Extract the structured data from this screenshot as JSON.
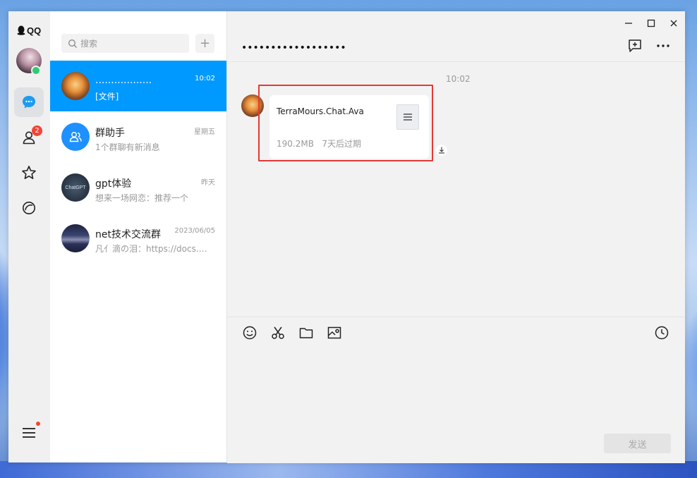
{
  "app": {
    "logo_text": "QQ"
  },
  "rail": {
    "badge_count": "2"
  },
  "search": {
    "placeholder": "搜索",
    "add_label": "+"
  },
  "conversations": [
    {
      "name": "..................",
      "message": "[文件]",
      "time": "10:02",
      "selected": true
    },
    {
      "name": "群助手",
      "message": "1个群聊有新消息",
      "time": "星期五"
    },
    {
      "name": "gpt体验",
      "message": "想来一场网恋：推荐一个",
      "time": "昨天",
      "avatar_text": "ChatGPT"
    },
    {
      "name": "net技术交流群",
      "message": "凡亻滴の泪：https://docs.…",
      "time": "2023/06/05"
    }
  ],
  "chat": {
    "title": "••••••••••••••••••",
    "message_time": "10:02",
    "file": {
      "name": "TerraMours.Chat.Ava",
      "size": "190.2MB",
      "expiry": "7天后过期"
    },
    "send_label": "发送"
  },
  "colors": {
    "accent": "#0099ff",
    "highlight": "#e53935",
    "online": "#2ecc71",
    "badge": "#f44336"
  }
}
